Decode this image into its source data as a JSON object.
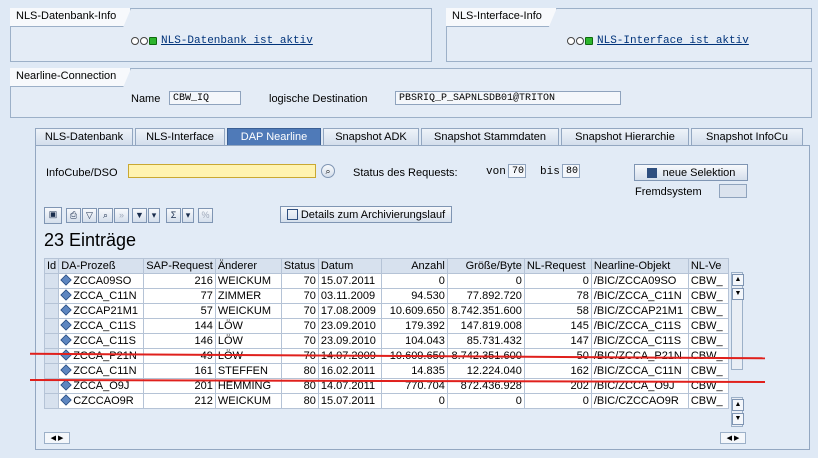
{
  "db_info": {
    "title": "NLS-Datenbank-Info",
    "status": "NLS-Datenbank ist aktiv"
  },
  "if_info": {
    "title": "NLS-Interface-Info",
    "status": "NLS-Interface ist aktiv"
  },
  "conn": {
    "title": "Nearline-Connection",
    "name_label": "Name",
    "name_value": "CBW_IQ",
    "dest_label": "logische Destination",
    "dest_value": "PBSRIQ_P_SAPNLSDB01@TRITON"
  },
  "tabs": [
    "NLS-Datenbank",
    "NLS-Interface",
    "DAP Nearline",
    "Snapshot ADK",
    "Snapshot Stammdaten",
    "Snapshot Hierarchie",
    "Snapshot InfoCu"
  ],
  "filter": {
    "infocube_label": "InfoCube/DSO",
    "status_label": "Status des Requests:",
    "von_label": "von",
    "von_value": "70",
    "bis_label": "bis",
    "bis_value": "80",
    "fremdsystem_label": "Fremdsystem",
    "neue_selektion": "neue Selektion"
  },
  "toolbar": {
    "details_label": "Details zum Archivierungslauf"
  },
  "count_label": "23 Einträge",
  "columns": [
    "Id",
    "DA-Prozeß",
    "SAP-Request",
    "Änderer",
    "Status",
    "Datum",
    "Anzahl",
    "Größe/Byte",
    "NL-Request",
    "Nearline-Objekt",
    "NL-Ve"
  ],
  "rows": [
    [
      "ZCCA09SO",
      "216",
      "WEICKUM",
      "70",
      "15.07.2011",
      "0",
      "0",
      "0",
      "/BIC/ZCCA09SO",
      "CBW_"
    ],
    [
      "ZCCA_C11N",
      "77",
      "ZIMMER",
      "70",
      "03.11.2009",
      "94.530",
      "77.892.720",
      "78",
      "/BIC/ZCCA_C11N",
      "CBW_"
    ],
    [
      "ZCCAP21M1",
      "57",
      "WEICKUM",
      "70",
      "17.08.2009",
      "10.609.650",
      "8.742.351.600",
      "58",
      "/BIC/ZCCAP21M1",
      "CBW_"
    ],
    [
      "ZCCA_C11S",
      "144",
      "LÖW",
      "70",
      "23.09.2010",
      "179.392",
      "147.819.008",
      "145",
      "/BIC/ZCCA_C11S",
      "CBW_"
    ],
    [
      "ZCCA_C11S",
      "146",
      "LÖW",
      "70",
      "23.09.2010",
      "104.043",
      "85.731.432",
      "147",
      "/BIC/ZCCA_C11S",
      "CBW_"
    ],
    [
      "ZCCA_P21N",
      "49",
      "LÖW",
      "70",
      "14.07.2009",
      "10.609.650",
      "8.742.351.600",
      "50",
      "/BIC/ZCCA_P21N",
      "CBW_"
    ],
    [
      "ZCCA_C11N",
      "161",
      "STEFFEN",
      "80",
      "16.02.2011",
      "14.835",
      "12.224.040",
      "162",
      "/BIC/ZCCA_C11N",
      "CBW_"
    ],
    [
      "ZCCA_O9J",
      "201",
      "HEMMING",
      "80",
      "14.07.2011",
      "770.704",
      "872.436.928",
      "202",
      "/BIC/ZCCA_O9J",
      "CBW_"
    ],
    [
      "CZCCAO9R",
      "212",
      "WEICKUM",
      "80",
      "15.07.2011",
      "0",
      "0",
      "0",
      "/BIC/CZCCAO9R",
      "CBW_"
    ]
  ]
}
